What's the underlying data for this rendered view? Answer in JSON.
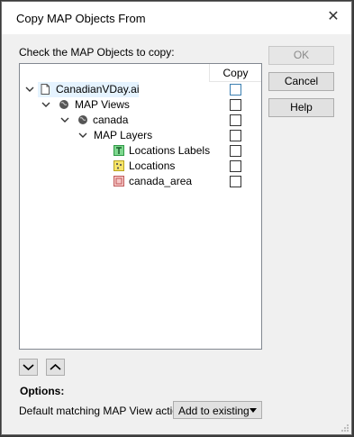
{
  "dialog": {
    "title": "Copy MAP Objects From",
    "close_glyph": "✕"
  },
  "instruction": "Check the MAP Objects to copy:",
  "tree": {
    "column_header": "Copy",
    "items": [
      {
        "label": "CanadianVDay.ai",
        "icon": "document-icon",
        "checked": false
      },
      {
        "label": "MAP Views",
        "icon": "globe-icon",
        "checked": false
      },
      {
        "label": "canada",
        "icon": "globe-icon",
        "checked": false
      },
      {
        "label": "MAP Layers",
        "icon": "none",
        "checked": false
      },
      {
        "label": "Locations Labels",
        "icon": "text-layer-icon",
        "checked": false
      },
      {
        "label": "Locations",
        "icon": "point-layer-icon",
        "checked": false
      },
      {
        "label": "canada_area",
        "icon": "area-layer-icon",
        "checked": false
      }
    ]
  },
  "buttons": {
    "ok": "OK",
    "cancel": "Cancel",
    "help": "Help"
  },
  "options": {
    "heading": "Options:",
    "match_label": "Default matching MAP View action:",
    "match_value": "Add to existing"
  }
}
